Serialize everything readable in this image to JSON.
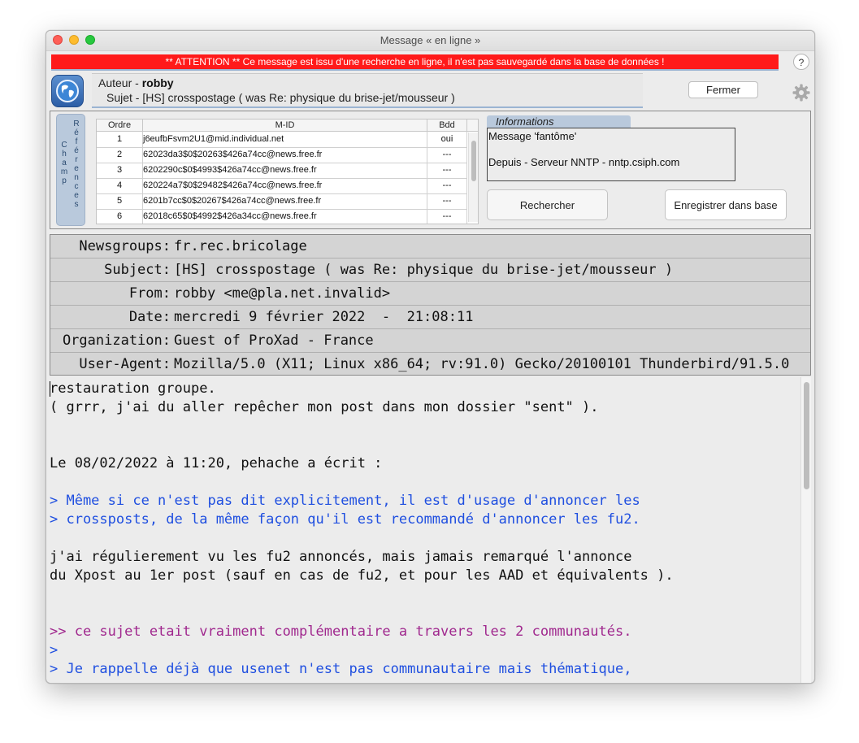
{
  "window": {
    "title": "Message « en ligne »"
  },
  "warning": "** ATTENTION **   Ce message est issu d'une recherche en ligne, il n'est pas sauvegardé dans la base de données !",
  "help_label": "?",
  "author": {
    "label": "Auteur - ",
    "name": "robby"
  },
  "subject_line": "Sujet - [HS] crosspostage ( was Re: physique du brise-jet/mousseur )",
  "close_label": "Fermer",
  "side_tab": {
    "champ": [
      "C",
      "h",
      "a",
      "m",
      "p"
    ],
    "references": [
      "R",
      "é",
      "f",
      "é",
      "r",
      "e",
      "n",
      "c",
      "e",
      "s"
    ]
  },
  "references": {
    "columns": {
      "ordre": "Ordre",
      "mid": "M-ID",
      "bdd": "Bdd"
    },
    "rows": [
      {
        "ordre": "1",
        "mid": "j6eufbFsvm2U1@mid.individual.net",
        "bdd": "oui"
      },
      {
        "ordre": "2",
        "mid": "62023da3$0$20263$426a74cc@news.free.fr",
        "bdd": "---"
      },
      {
        "ordre": "3",
        "mid": "6202290c$0$4993$426a74cc@news.free.fr",
        "bdd": "---"
      },
      {
        "ordre": "4",
        "mid": "620224a7$0$29482$426a74cc@news.free.fr",
        "bdd": "---"
      },
      {
        "ordre": "5",
        "mid": "6201b7cc$0$20267$426a74cc@news.free.fr",
        "bdd": "---"
      },
      {
        "ordre": "6",
        "mid": "62018c65$0$4992$426a34cc@news.free.fr",
        "bdd": "---"
      }
    ]
  },
  "info": {
    "tab": "Informations",
    "line1": "Message 'fantôme'",
    "line2": "Depuis - Serveur NNTP - nntp.csiph.com"
  },
  "buttons": {
    "search": "Rechercher",
    "save": "Enregistrer dans base"
  },
  "headers": {
    "newsgroups": {
      "label": "Newsgroups:",
      "value": "fr.rec.bricolage"
    },
    "subject": {
      "label": "Subject:",
      "value": "[HS] crosspostage ( was Re: physique du brise-jet/mousseur )"
    },
    "from": {
      "label": "From:",
      "value": "robby <me@pla.net.invalid>"
    },
    "date": {
      "label": "Date:",
      "value": "mercredi 9 février 2022  -  21:08:11"
    },
    "organization": {
      "label": "Organization:",
      "value": "Guest of ProXad - France"
    },
    "user_agent": {
      "label": "User-Agent:",
      "value": "Mozilla/5.0 (X11; Linux x86_64; rv:91.0) Gecko/20100101 Thunderbird/91.5.0"
    }
  },
  "body": {
    "l1": "restauration groupe.",
    "l2": "( grrr, j'ai du aller repêcher mon post dans mon dossier \"sent\" ).",
    "l3": "Le 08/02/2022 à 11:20, pehache a écrit :",
    "l4": "> Même si ce n'est pas dit explicitement, il est d'usage d'annoncer les",
    "l5": "> crossposts, de la même façon qu'il est recommandé d'annoncer les fu2.",
    "l6": "j'ai régulierement vu les fu2 annoncés, mais jamais remarqué l'annonce",
    "l7": "du Xpost au 1er post (sauf en cas de fu2, et pour les AAD et équivalents ).",
    "l8": ">> ce sujet etait vraiment complémentaire a travers les 2 communautés.",
    "l9": ">",
    "l10": "> Je rappelle déjà que usenet n'est pas communautaire mais thématique,"
  },
  "colors": {
    "warning_bg": "#ff1a1a",
    "quote_level1": "#1f4fe0",
    "quote_level2": "#a0288e",
    "tab_blue": "#b9c9dc"
  }
}
